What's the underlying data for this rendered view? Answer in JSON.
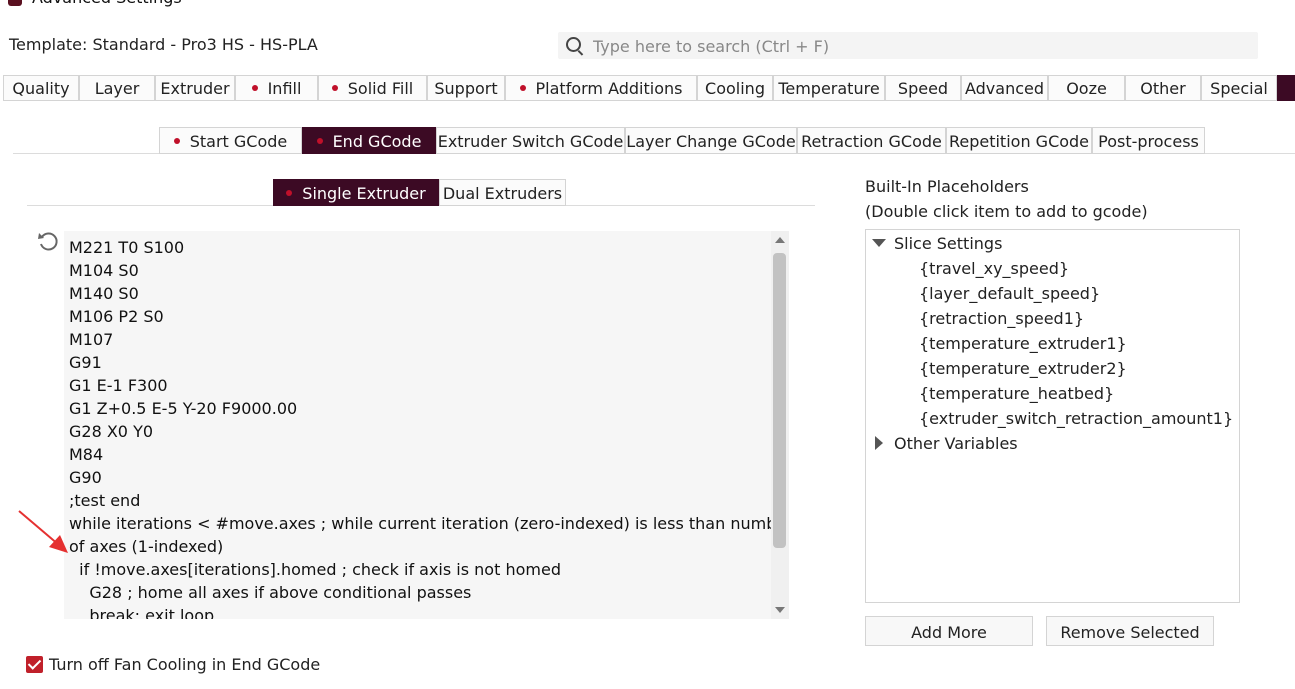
{
  "window": {
    "title": "Advanced Settings"
  },
  "template": {
    "label": "Template: Standard - Pro3 HS - HS-PLA"
  },
  "search": {
    "placeholder": "Type here to search (Ctrl + F)"
  },
  "main_tabs": [
    {
      "label": "Quality",
      "dot": false
    },
    {
      "label": "Layer",
      "dot": false
    },
    {
      "label": "Extruder",
      "dot": false
    },
    {
      "label": "Infill",
      "dot": true
    },
    {
      "label": "Solid Fill",
      "dot": true
    },
    {
      "label": "Support",
      "dot": false
    },
    {
      "label": "Platform Additions",
      "dot": true
    },
    {
      "label": "Cooling",
      "dot": false
    },
    {
      "label": "Temperature",
      "dot": false
    },
    {
      "label": "Speed",
      "dot": false
    },
    {
      "label": "Advanced",
      "dot": false
    },
    {
      "label": "Ooze",
      "dot": false
    },
    {
      "label": "Other",
      "dot": false
    },
    {
      "label": "Special",
      "dot": false
    }
  ],
  "gcode_tabs": [
    {
      "label": "Start GCode",
      "dot": true,
      "active": false
    },
    {
      "label": "End GCode",
      "dot": true,
      "active": true
    },
    {
      "label": "Extruder Switch GCode",
      "dot": false,
      "active": false
    },
    {
      "label": "Layer Change GCode",
      "dot": false,
      "active": false
    },
    {
      "label": "Retraction GCode",
      "dot": false,
      "active": false
    },
    {
      "label": "Repetition GCode",
      "dot": false,
      "active": false
    },
    {
      "label": "Post-process",
      "dot": false,
      "active": false
    }
  ],
  "extruder_tabs": [
    {
      "label": "Single Extruder",
      "dot": true,
      "active": true
    },
    {
      "label": "Dual Extruders",
      "dot": false,
      "active": false
    }
  ],
  "editor": {
    "lines": [
      "M221 T0 S100",
      "M104 S0",
      "M140 S0",
      "M106 P2 S0",
      "M107",
      "G91",
      "G1 E-1 F300",
      "G1 Z+0.5 E-5 Y-20 F9000.00",
      "G28 X0 Y0",
      "M84",
      "G90",
      ";test end",
      "while iterations < #move.axes ; while current iteration (zero-indexed) is less than number",
      "of axes (1-indexed)",
      "  if !move.axes[iterations].homed ; check if axis is not homed",
      "    G28 ; home all axes if above conditional passes",
      "    break; exit loop"
    ]
  },
  "placeholders": {
    "title": "Built-In Placeholders",
    "subtitle": "(Double click item to add to gcode)",
    "groups": [
      {
        "label": "Slice Settings",
        "expanded": true,
        "items": [
          "{travel_xy_speed}",
          "{layer_default_speed}",
          "{retraction_speed1}",
          "{temperature_extruder1}",
          "{temperature_extruder2}",
          "{temperature_heatbed}",
          "{extruder_switch_retraction_amount1}"
        ]
      },
      {
        "label": "Other Variables",
        "expanded": false,
        "items": []
      }
    ],
    "add_more_label": "Add More",
    "remove_selected_label": "Remove Selected"
  },
  "fan_cooling": {
    "label": "Turn off Fan Cooling in End GCode",
    "checked": true
  },
  "colors": {
    "accent": "#3c0a24",
    "dot": "#c0102a",
    "checkbox": "#c0202a",
    "arrow": "#e53030"
  }
}
